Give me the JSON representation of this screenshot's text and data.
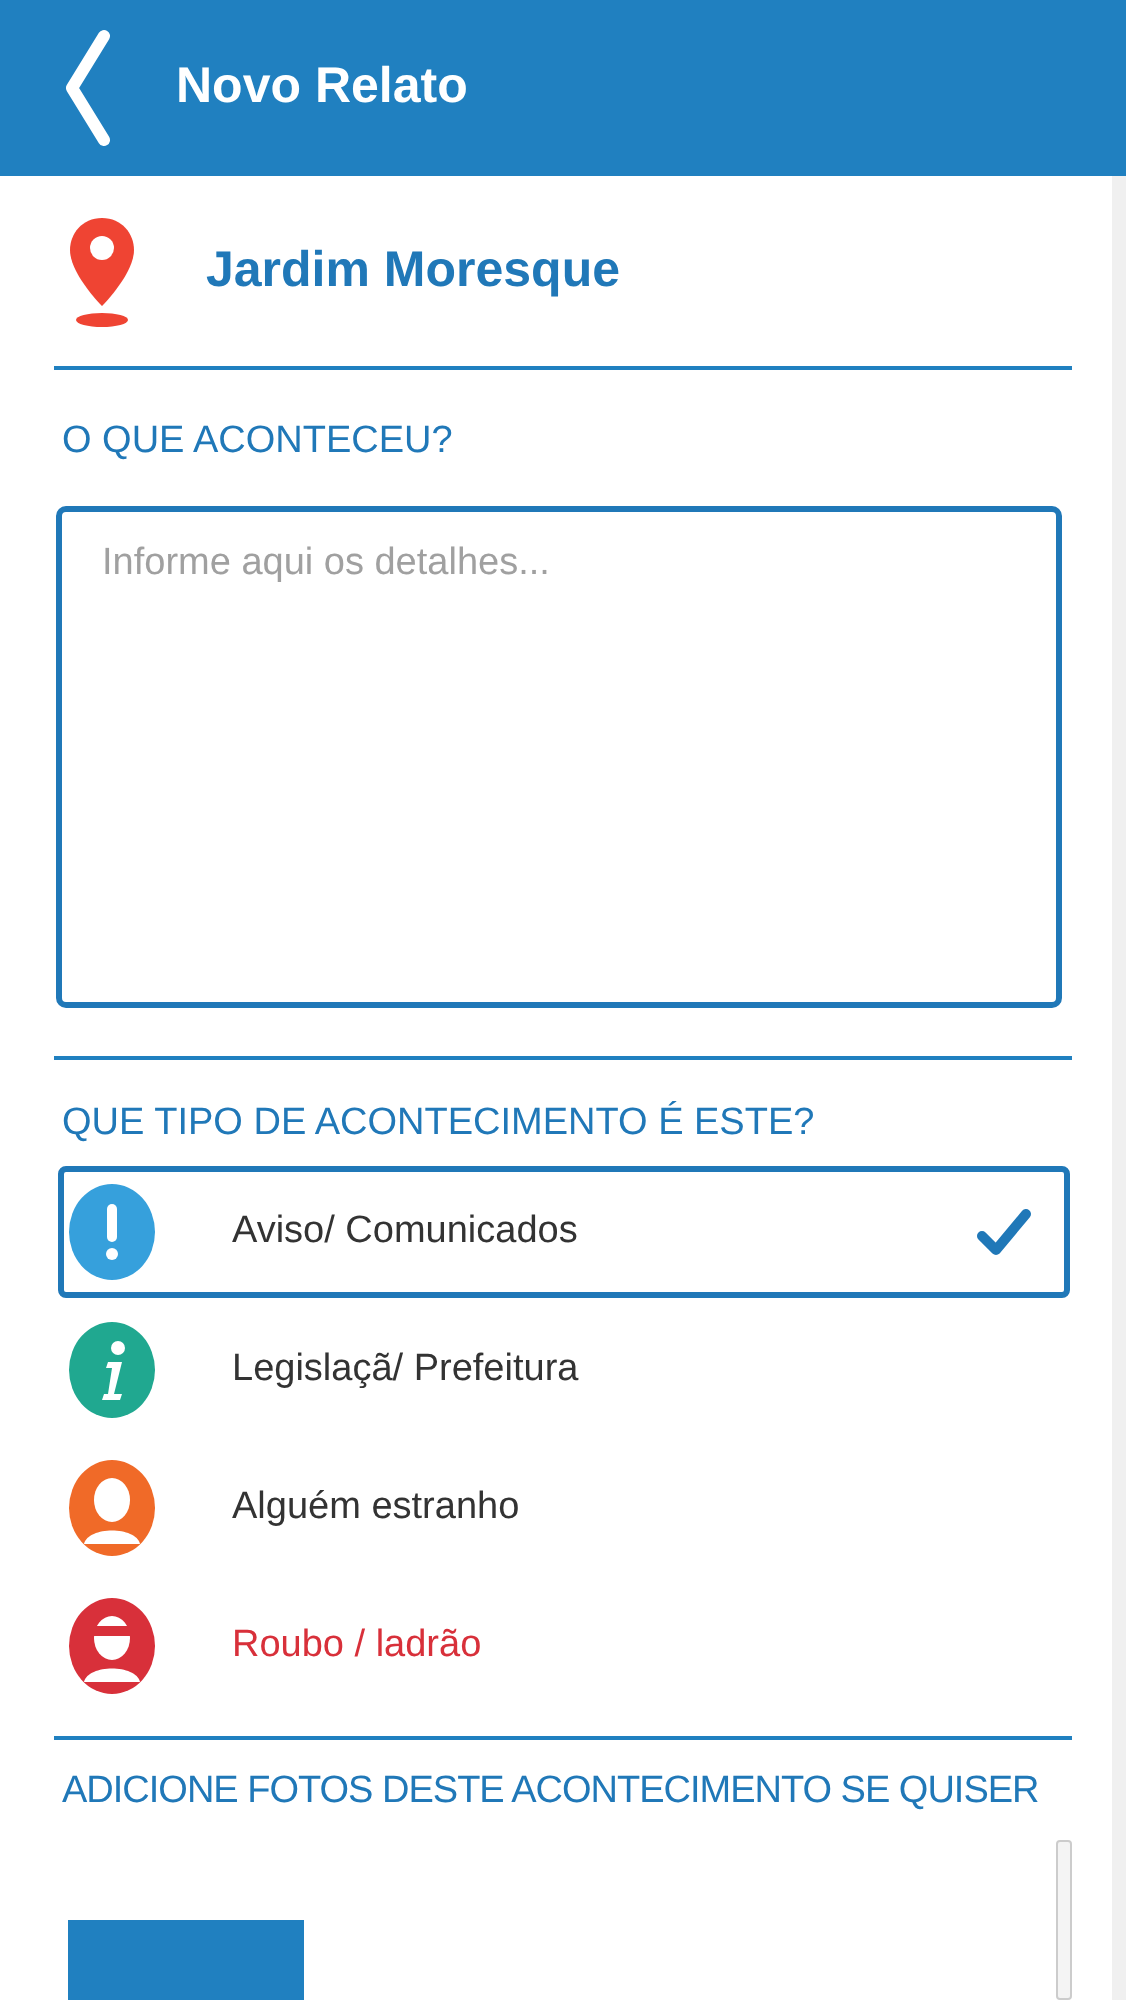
{
  "header": {
    "title": "Novo Relato"
  },
  "location": {
    "name": "Jardim Moresque"
  },
  "details": {
    "heading": "O QUE ACONTECEU?",
    "placeholder": "Informe aqui os detalhes..."
  },
  "event_types": {
    "heading": "QUE TIPO DE ACONTECIMENTO É ESTE?",
    "items": [
      {
        "kind": "alert",
        "label": "Aviso/ Comunicados",
        "color": "#36a0dc",
        "selected": true,
        "warning": false
      },
      {
        "kind": "info",
        "label": "Legislaçã/ Prefeitura",
        "color": "#20a890",
        "selected": false,
        "warning": false
      },
      {
        "kind": "person",
        "label": "Alguém estranho",
        "color": "#f06a28",
        "selected": false,
        "warning": false
      },
      {
        "kind": "thief",
        "label": "Roubo / ladrão",
        "color": "#d8303a",
        "selected": false,
        "warning": true
      }
    ]
  },
  "photos": {
    "heading": "ADICIONE FOTOS DESTE ACONTECIMENTO SE QUISER"
  }
}
